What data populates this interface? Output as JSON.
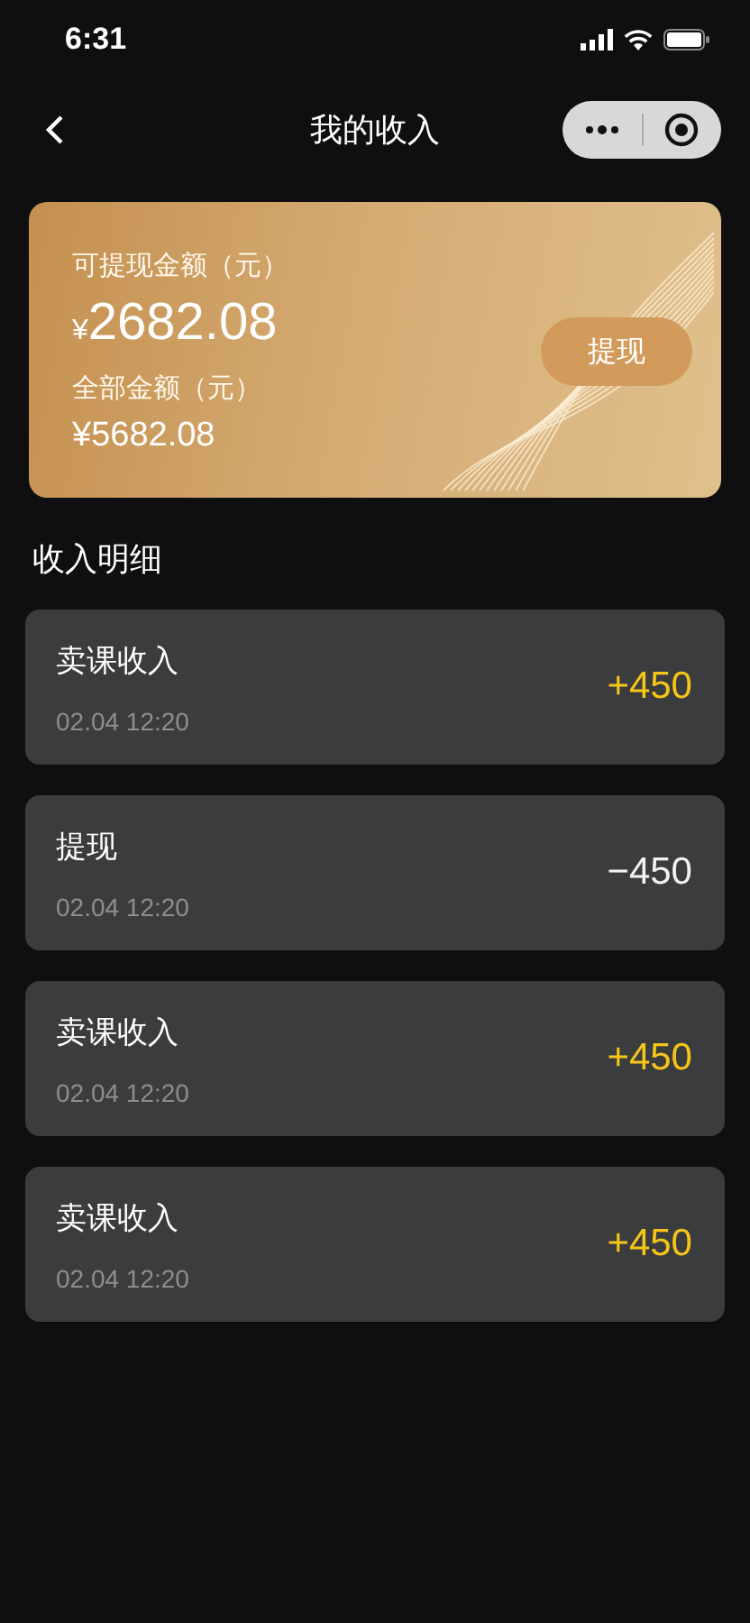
{
  "status_bar": {
    "time": "6:31"
  },
  "nav": {
    "title": "我的收入"
  },
  "balance_card": {
    "available_label": "可提现金额（元）",
    "available_currency": "¥",
    "available_amount": "2682.08",
    "total_label": "全部金额（元）",
    "total_amount": "¥5682.08",
    "withdraw_button": "提现"
  },
  "section_title": "收入明细",
  "records": [
    {
      "title": "卖课收入",
      "time": "02.04 12:20",
      "amount": "+450",
      "kind": "income"
    },
    {
      "title": "提现",
      "time": "02.04 12:20",
      "amount": "−450",
      "kind": "withdrawal"
    },
    {
      "title": "卖课收入",
      "time": "02.04 12:20",
      "amount": "+450",
      "kind": "income"
    },
    {
      "title": "卖课收入",
      "time": "02.04 12:20",
      "amount": "+450",
      "kind": "income"
    }
  ]
}
